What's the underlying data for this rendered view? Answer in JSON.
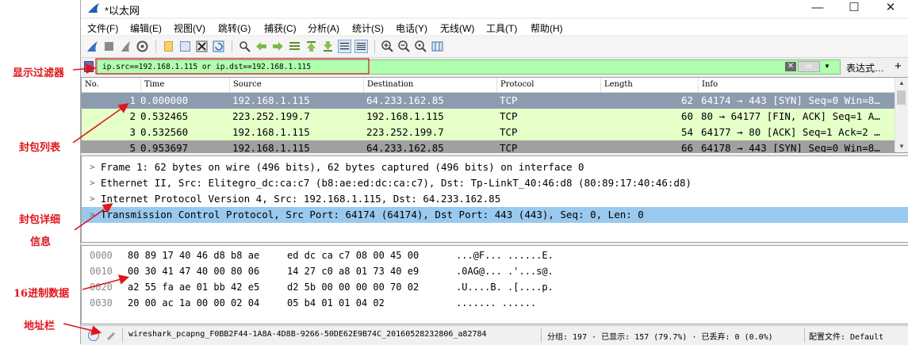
{
  "annotations": {
    "filter": "显示过滤器",
    "packet_list": "封包列表",
    "details_line1": "封包详细",
    "details_line2": "信息",
    "hex": "16进制数据",
    "address_bar": "地址栏",
    "color": "#e0151a"
  },
  "window": {
    "title": "*以太网",
    "minimize": "—",
    "maximize": "☐",
    "close": "✕"
  },
  "menu": [
    {
      "label": "文件(F)"
    },
    {
      "label": "编辑(E)"
    },
    {
      "label": "视图(V)"
    },
    {
      "label": "跳转(G)"
    },
    {
      "label": "捕获(C)"
    },
    {
      "label": "分析(A)"
    },
    {
      "label": "统计(S)"
    },
    {
      "label": "电话(Y)"
    },
    {
      "label": "无线(W)"
    },
    {
      "label": "工具(T)"
    },
    {
      "label": "帮助(H)"
    }
  ],
  "toolbar": {
    "icons": [
      "start-capture-icon",
      "stop-capture-icon",
      "restart-capture-icon",
      "capture-options-icon",
      "open-file-icon",
      "save-file-icon",
      "close-file-icon",
      "reload-file-icon",
      "find-packet-icon",
      "go-back-icon",
      "go-forward-icon",
      "go-to-packet-icon",
      "go-first-icon",
      "go-last-icon",
      "autoscroll-icon",
      "colorize-icon",
      "zoom-in-icon",
      "zoom-out-icon",
      "zoom-normal-icon",
      "resize-columns-icon"
    ]
  },
  "filter": {
    "value": "ip.src==192.168.1.115 or ip.dst==192.168.1.115",
    "expression_label": "表达式…",
    "plus_label": "+",
    "clear_label": "✕",
    "apply_label": "⇨",
    "bg_color": "#afffaf"
  },
  "packet_list": {
    "columns": [
      {
        "key": "no",
        "label": "No."
      },
      {
        "key": "time",
        "label": "Time"
      },
      {
        "key": "source",
        "label": "Source"
      },
      {
        "key": "destination",
        "label": "Destination"
      },
      {
        "key": "protocol",
        "label": "Protocol"
      },
      {
        "key": "length",
        "label": "Length"
      },
      {
        "key": "info",
        "label": "Info"
      }
    ],
    "rows": [
      {
        "no": "1",
        "time": "0.000000",
        "source": "192.168.1.115",
        "destination": "64.233.162.85",
        "protocol": "TCP",
        "length": "62",
        "info": "64174 → 443 [SYN] Seq=0 Win=8…",
        "bg": "#8d9bb0",
        "fg": "#ffffff"
      },
      {
        "no": "2",
        "time": "0.532465",
        "source": "223.252.199.7",
        "destination": "192.168.1.115",
        "protocol": "TCP",
        "length": "60",
        "info": "80 → 64177 [FIN, ACK] Seq=1 A…",
        "bg": "#e5ffc8",
        "fg": "#000000"
      },
      {
        "no": "3",
        "time": "0.532560",
        "source": "192.168.1.115",
        "destination": "223.252.199.7",
        "protocol": "TCP",
        "length": "54",
        "info": "64177 → 80 [ACK] Seq=1 Ack=2 …",
        "bg": "#e5ffc8",
        "fg": "#000000"
      },
      {
        "no": "5",
        "time": "0.953697",
        "source": "192.168.1.115",
        "destination": "64.233.162.85",
        "protocol": "TCP",
        "length": "66",
        "info": "64178 → 443 [SYN] Seq=0 Win=8…",
        "bg": "#a0a0a0",
        "fg": "#000000"
      }
    ]
  },
  "details": {
    "rows": [
      {
        "text": "Frame 1: 62 bytes on wire (496 bits), 62 bytes captured (496 bits) on interface 0",
        "selected": false
      },
      {
        "text": "Ethernet II, Src: Elitegro_dc:ca:c7 (b8:ae:ed:dc:ca:c7), Dst: Tp-LinkT_40:46:d8 (80:89:17:40:46:d8)",
        "selected": false
      },
      {
        "text": "Internet Protocol Version 4, Src: 192.168.1.115, Dst: 64.233.162.85",
        "selected": false
      },
      {
        "text": "Transmission Control Protocol, Src Port: 64174 (64174), Dst Port: 443 (443), Seq: 0, Len: 0",
        "selected": true
      }
    ],
    "expand_glyph": ">",
    "selected_color": "#99c9ef"
  },
  "hex": {
    "rows": [
      {
        "offset": "0000",
        "b1": "80 89 17 40 46 d8 b8 ae",
        "b2": "ed dc ca c7 08 00 45 00",
        "ascii": "...@F... ......E."
      },
      {
        "offset": "0010",
        "b1": "00 30 41 47 40 00 80 06",
        "b2": "14 27 c0 a8 01 73 40 e9",
        "ascii": ".0AG@... .'...s@."
      },
      {
        "offset": "0020",
        "b1": "a2 55 fa ae 01 bb 42 e5",
        "b2": "d2 5b 00 00 00 00 70 02",
        "ascii": ".U....B. .[....p."
      },
      {
        "offset": "0030",
        "b1": "20 00 ac 1a 00 00 02 04",
        "b2": "05 b4 01 01 04 02",
        "ascii": " ....... ......"
      }
    ]
  },
  "status": {
    "file": "wireshark_pcapng_F0BB2F44-1A8A-4D8B-9266-50DE62E9B74C_20160528232806_a82784",
    "packets": "分组: 197 · 已显示: 157 (79.7%) · 已丢弃: 0 (0.0%)",
    "profile": "配置文件: Default"
  }
}
